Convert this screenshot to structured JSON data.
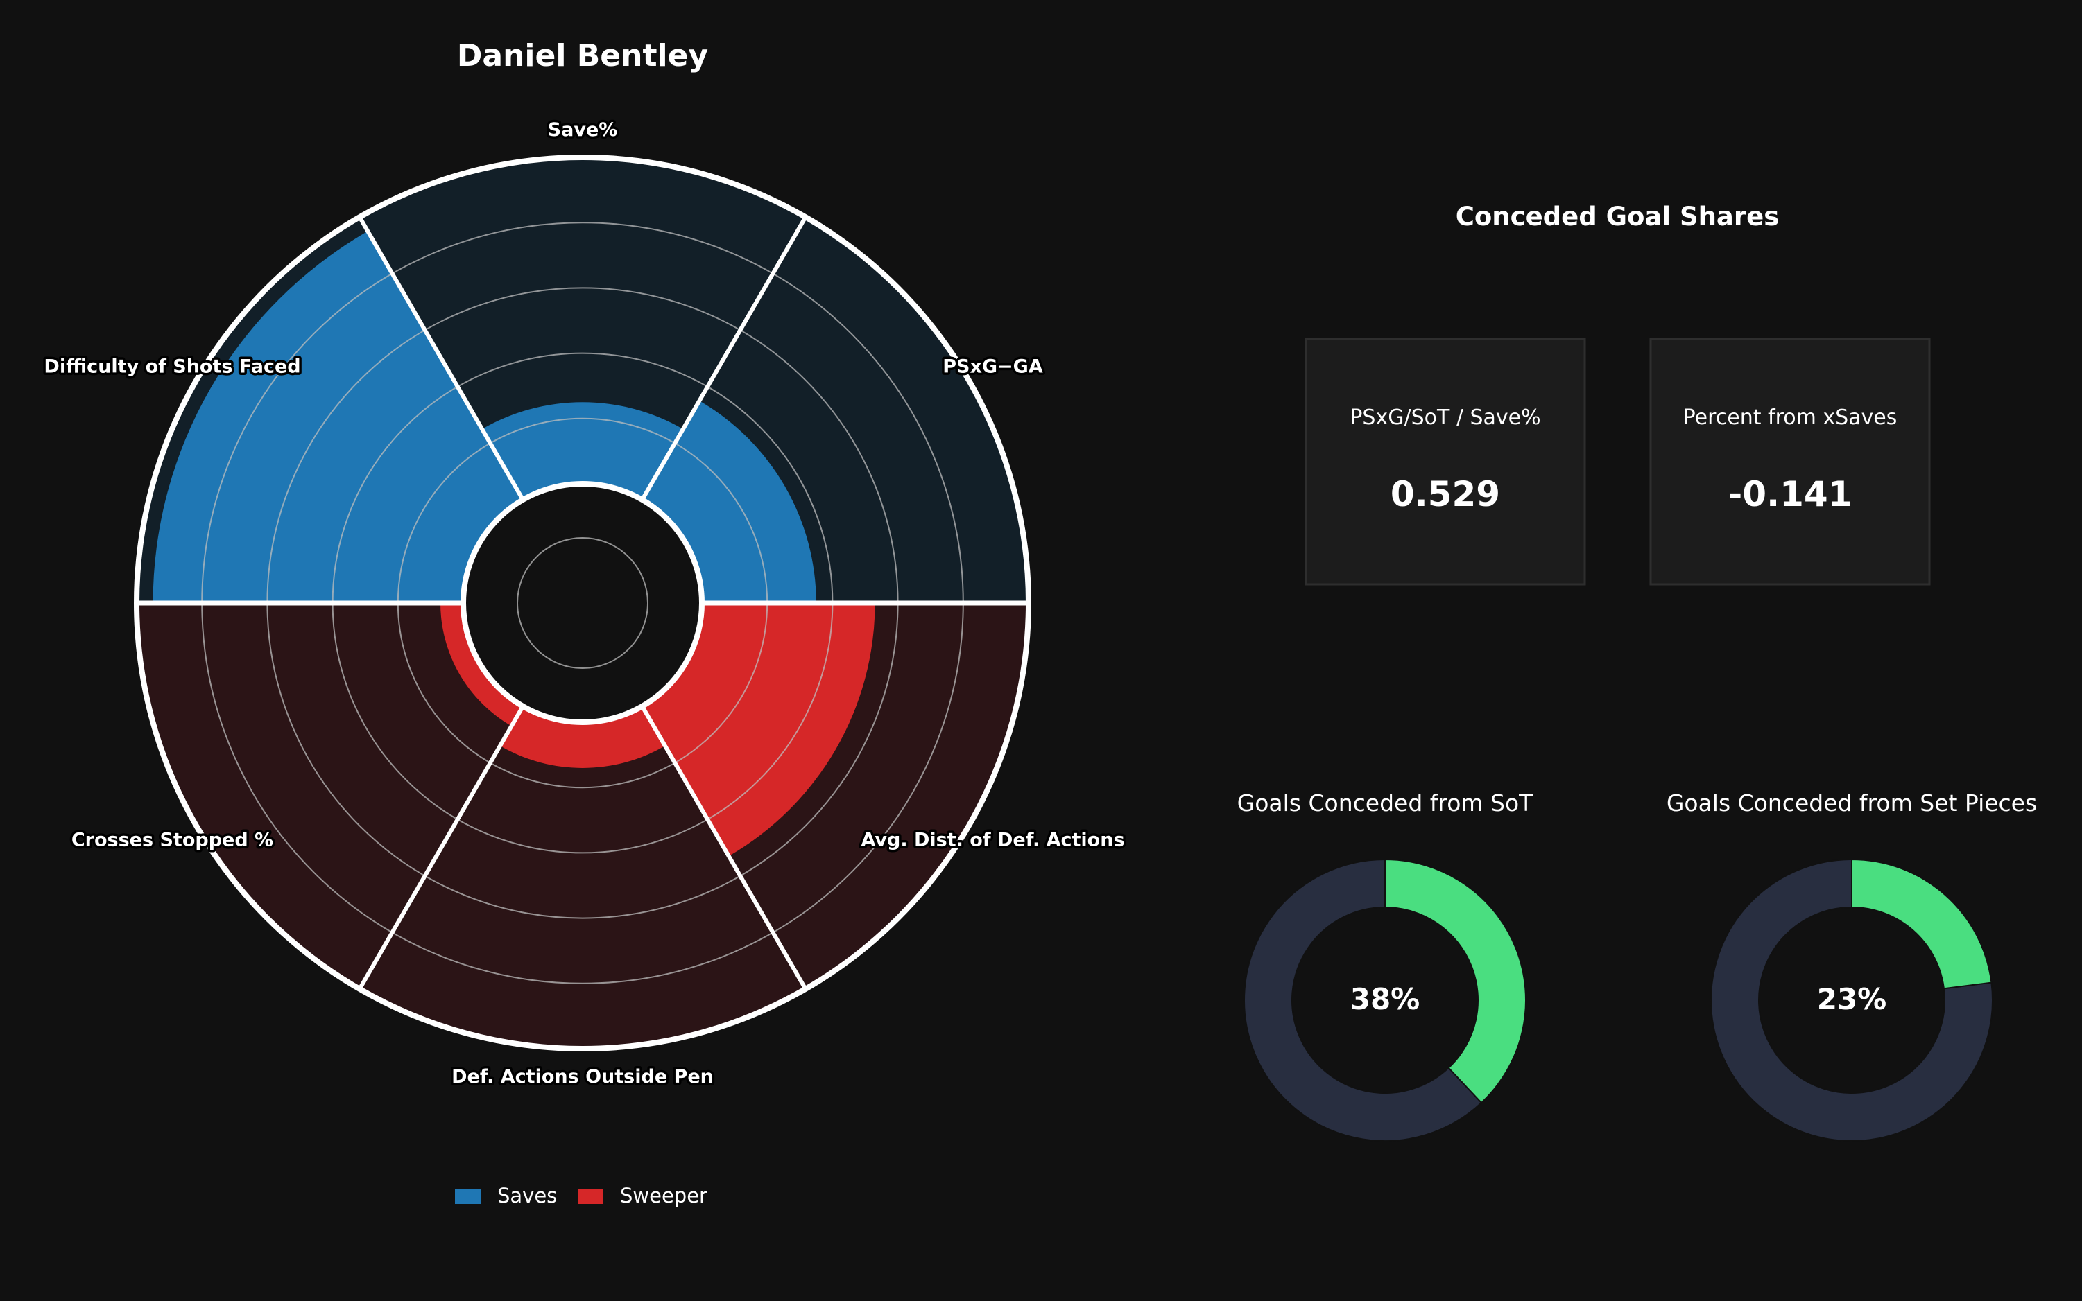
{
  "colors": {
    "background": "#111111",
    "saves": "#1f77b4",
    "sweeper": "#d62728",
    "saves_track": "#121f28",
    "sweeper_track": "#2b1416",
    "card_bg": "#1c1c1c",
    "donut_fill": "#4ade80",
    "donut_track": "#282e40"
  },
  "chart_data": [
    {
      "type": "polar-bar",
      "title": "Daniel Bentley",
      "r_max": 100,
      "gridlines": [
        20,
        40,
        60,
        80
      ],
      "categories": [
        "Save%",
        "PSxG−GA",
        "Avg. Dist. of Def. Actions",
        "Def. Actions Outside Pen",
        "Crosses Stopped %",
        "Difficulty of Shots Faced"
      ],
      "series": [
        {
          "name": "Saves",
          "values": [
            25,
            35,
            null,
            null,
            null,
            95
          ]
        },
        {
          "name": "Sweeper",
          "values": [
            null,
            null,
            53,
            14,
            7,
            null
          ]
        }
      ],
      "legend": {
        "placement": "bottom",
        "items": [
          "Saves",
          "Sweeper"
        ]
      }
    },
    {
      "type": "table",
      "title": "Conceded Goal Shares",
      "cards": [
        {
          "label": "PSxG/SoT / Save%",
          "value": "0.529"
        },
        {
          "label": "Percent from xSaves",
          "value": "-0.141"
        }
      ]
    },
    {
      "type": "pie",
      "title": "Goals Conceded from SoT",
      "value": 38,
      "label": "38%"
    },
    {
      "type": "pie",
      "title": "Goals Conceded from Set Pieces",
      "value": 23,
      "label": "23%"
    }
  ]
}
